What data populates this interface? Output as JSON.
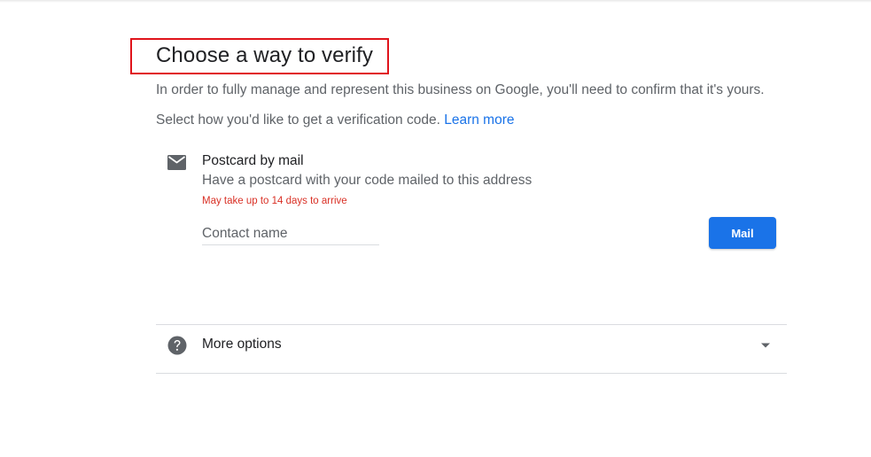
{
  "header": {
    "title": "Choose a way to verify",
    "description": "In order to fully manage and represent this business on Google, you'll need to confirm that it's yours.",
    "instruction": "Select how you'd like to get a verification code.",
    "learn_more": "Learn more"
  },
  "postcard_option": {
    "icon": "mail-icon",
    "title": "Postcard by mail",
    "description": "Have a postcard with your code mailed to this address",
    "warning": "May take up to 14 days to arrive",
    "contact_placeholder": "Contact name",
    "contact_value": "",
    "button_label": "Mail"
  },
  "more_options": {
    "icon": "help-icon",
    "label": "More options",
    "toggle_icon": "chevron-down-icon"
  },
  "colors": {
    "accent": "#1a73e8",
    "warning": "#d93025",
    "highlight_box": "#e0141b"
  }
}
